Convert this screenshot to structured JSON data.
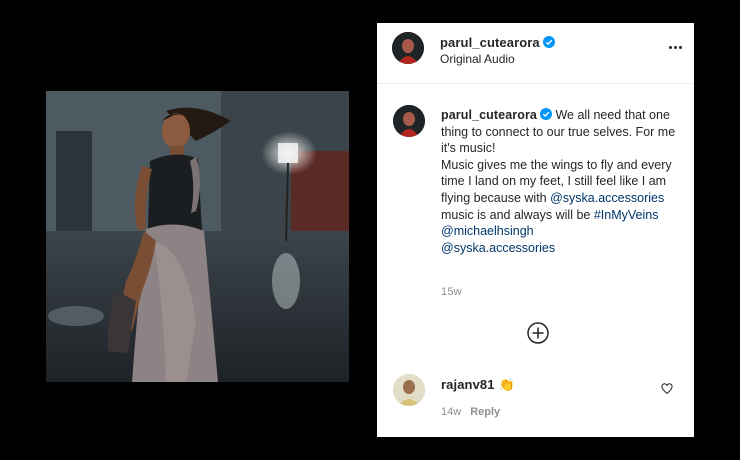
{
  "post": {
    "author": "parul_cutearora",
    "audio": "Original Audio",
    "verified_icon": "verified-badge-icon",
    "more_icon": "more-options-icon",
    "accent_color": "#0095f6",
    "link_color": "#00376b"
  },
  "caption": {
    "username": "parul_cutearora",
    "text_1": "We all need that one thing to connect to our true selves. For me it's music!",
    "text_2": "Music gives me the wings to fly and every time I land on my feet, I still feel like I am flying because with",
    "mention_1": "@syska.accessories",
    "text_3": "music is and always will be",
    "hashtag": "#InMyVeins",
    "mention_2": "@michaelhsingh",
    "mention_3": "@syska.accessories",
    "time": "15w"
  },
  "load_more_icon": "plus-circle-icon",
  "comment": {
    "username": "rajanv81",
    "emoji": "👏",
    "time": "14w",
    "reply_label": "Reply",
    "like_icon": "heart-icon"
  }
}
